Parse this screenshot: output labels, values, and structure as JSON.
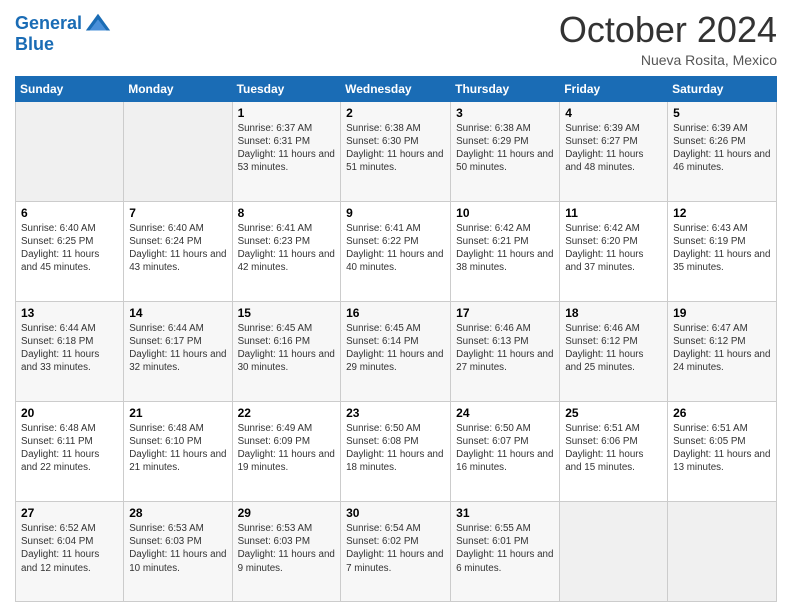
{
  "header": {
    "logo_line1": "General",
    "logo_line2": "Blue",
    "month": "October 2024",
    "location": "Nueva Rosita, Mexico"
  },
  "days_of_week": [
    "Sunday",
    "Monday",
    "Tuesday",
    "Wednesday",
    "Thursday",
    "Friday",
    "Saturday"
  ],
  "weeks": [
    [
      {
        "day": "",
        "content": ""
      },
      {
        "day": "",
        "content": ""
      },
      {
        "day": "1",
        "content": "Sunrise: 6:37 AM\nSunset: 6:31 PM\nDaylight: 11 hours and 53 minutes."
      },
      {
        "day": "2",
        "content": "Sunrise: 6:38 AM\nSunset: 6:30 PM\nDaylight: 11 hours and 51 minutes."
      },
      {
        "day": "3",
        "content": "Sunrise: 6:38 AM\nSunset: 6:29 PM\nDaylight: 11 hours and 50 minutes."
      },
      {
        "day": "4",
        "content": "Sunrise: 6:39 AM\nSunset: 6:27 PM\nDaylight: 11 hours and 48 minutes."
      },
      {
        "day": "5",
        "content": "Sunrise: 6:39 AM\nSunset: 6:26 PM\nDaylight: 11 hours and 46 minutes."
      }
    ],
    [
      {
        "day": "6",
        "content": "Sunrise: 6:40 AM\nSunset: 6:25 PM\nDaylight: 11 hours and 45 minutes."
      },
      {
        "day": "7",
        "content": "Sunrise: 6:40 AM\nSunset: 6:24 PM\nDaylight: 11 hours and 43 minutes."
      },
      {
        "day": "8",
        "content": "Sunrise: 6:41 AM\nSunset: 6:23 PM\nDaylight: 11 hours and 42 minutes."
      },
      {
        "day": "9",
        "content": "Sunrise: 6:41 AM\nSunset: 6:22 PM\nDaylight: 11 hours and 40 minutes."
      },
      {
        "day": "10",
        "content": "Sunrise: 6:42 AM\nSunset: 6:21 PM\nDaylight: 11 hours and 38 minutes."
      },
      {
        "day": "11",
        "content": "Sunrise: 6:42 AM\nSunset: 6:20 PM\nDaylight: 11 hours and 37 minutes."
      },
      {
        "day": "12",
        "content": "Sunrise: 6:43 AM\nSunset: 6:19 PM\nDaylight: 11 hours and 35 minutes."
      }
    ],
    [
      {
        "day": "13",
        "content": "Sunrise: 6:44 AM\nSunset: 6:18 PM\nDaylight: 11 hours and 33 minutes."
      },
      {
        "day": "14",
        "content": "Sunrise: 6:44 AM\nSunset: 6:17 PM\nDaylight: 11 hours and 32 minutes."
      },
      {
        "day": "15",
        "content": "Sunrise: 6:45 AM\nSunset: 6:16 PM\nDaylight: 11 hours and 30 minutes."
      },
      {
        "day": "16",
        "content": "Sunrise: 6:45 AM\nSunset: 6:14 PM\nDaylight: 11 hours and 29 minutes."
      },
      {
        "day": "17",
        "content": "Sunrise: 6:46 AM\nSunset: 6:13 PM\nDaylight: 11 hours and 27 minutes."
      },
      {
        "day": "18",
        "content": "Sunrise: 6:46 AM\nSunset: 6:12 PM\nDaylight: 11 hours and 25 minutes."
      },
      {
        "day": "19",
        "content": "Sunrise: 6:47 AM\nSunset: 6:12 PM\nDaylight: 11 hours and 24 minutes."
      }
    ],
    [
      {
        "day": "20",
        "content": "Sunrise: 6:48 AM\nSunset: 6:11 PM\nDaylight: 11 hours and 22 minutes."
      },
      {
        "day": "21",
        "content": "Sunrise: 6:48 AM\nSunset: 6:10 PM\nDaylight: 11 hours and 21 minutes."
      },
      {
        "day": "22",
        "content": "Sunrise: 6:49 AM\nSunset: 6:09 PM\nDaylight: 11 hours and 19 minutes."
      },
      {
        "day": "23",
        "content": "Sunrise: 6:50 AM\nSunset: 6:08 PM\nDaylight: 11 hours and 18 minutes."
      },
      {
        "day": "24",
        "content": "Sunrise: 6:50 AM\nSunset: 6:07 PM\nDaylight: 11 hours and 16 minutes."
      },
      {
        "day": "25",
        "content": "Sunrise: 6:51 AM\nSunset: 6:06 PM\nDaylight: 11 hours and 15 minutes."
      },
      {
        "day": "26",
        "content": "Sunrise: 6:51 AM\nSunset: 6:05 PM\nDaylight: 11 hours and 13 minutes."
      }
    ],
    [
      {
        "day": "27",
        "content": "Sunrise: 6:52 AM\nSunset: 6:04 PM\nDaylight: 11 hours and 12 minutes."
      },
      {
        "day": "28",
        "content": "Sunrise: 6:53 AM\nSunset: 6:03 PM\nDaylight: 11 hours and 10 minutes."
      },
      {
        "day": "29",
        "content": "Sunrise: 6:53 AM\nSunset: 6:03 PM\nDaylight: 11 hours and 9 minutes."
      },
      {
        "day": "30",
        "content": "Sunrise: 6:54 AM\nSunset: 6:02 PM\nDaylight: 11 hours and 7 minutes."
      },
      {
        "day": "31",
        "content": "Sunrise: 6:55 AM\nSunset: 6:01 PM\nDaylight: 11 hours and 6 minutes."
      },
      {
        "day": "",
        "content": ""
      },
      {
        "day": "",
        "content": ""
      }
    ]
  ]
}
